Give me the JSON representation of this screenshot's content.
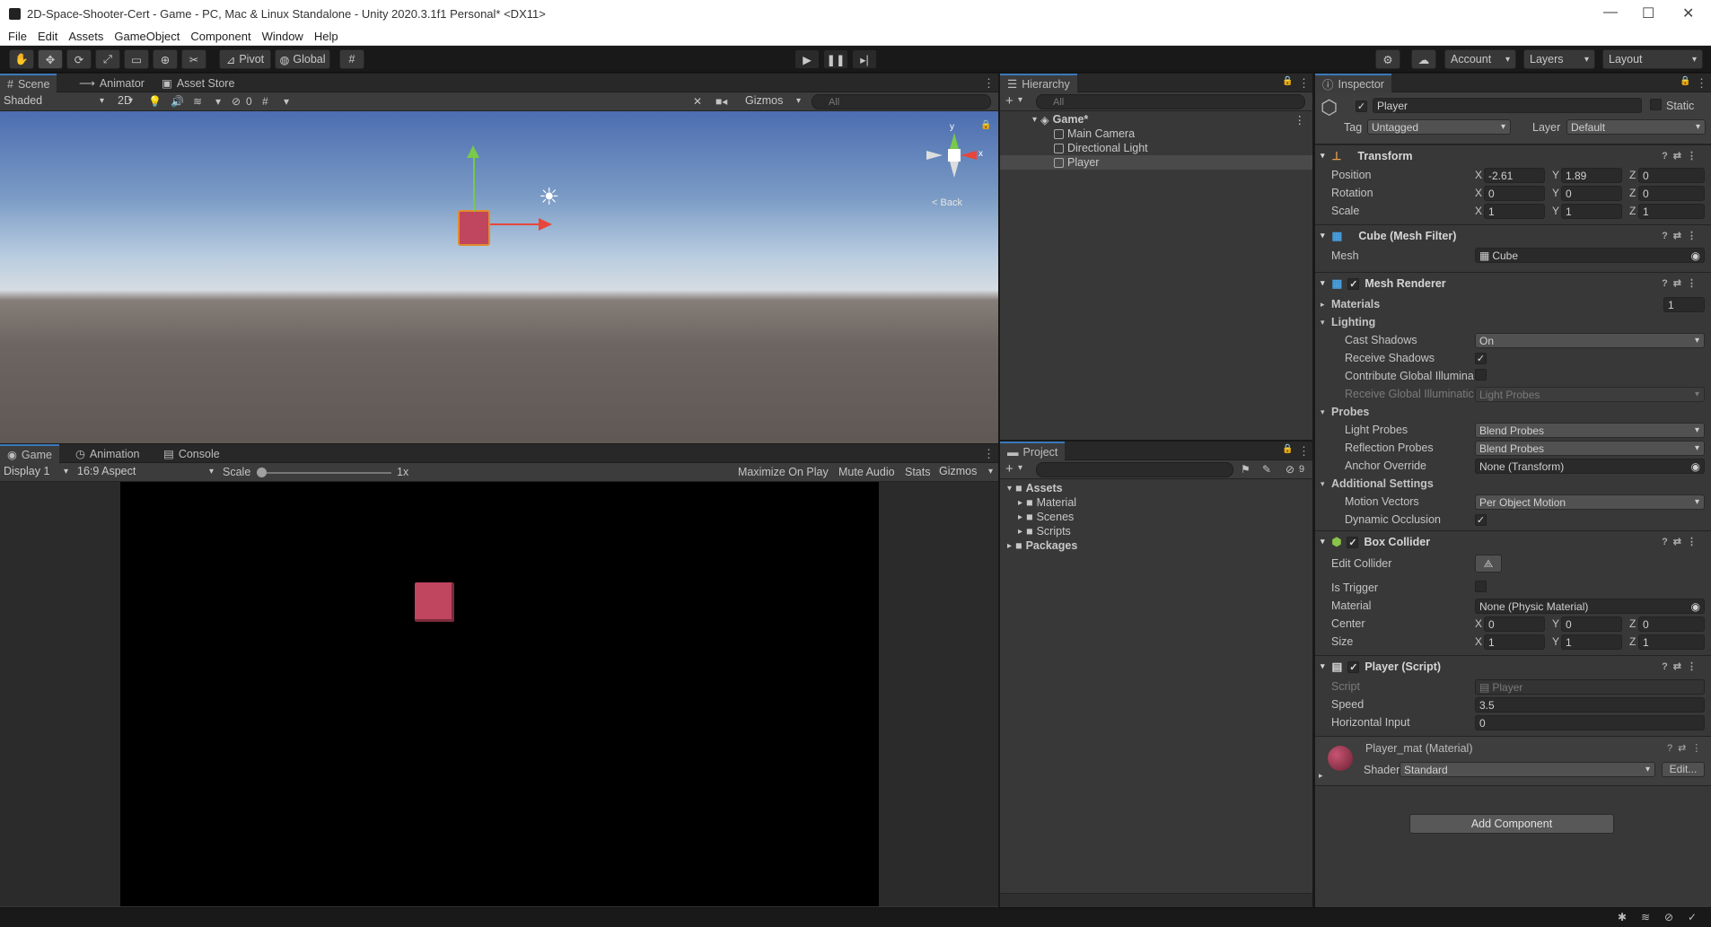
{
  "window": {
    "title": "2D-Space-Shooter-Cert - Game - PC, Mac & Linux Standalone - Unity 2020.3.1f1 Personal* <DX11>"
  },
  "menu": [
    "File",
    "Edit",
    "Assets",
    "GameObject",
    "Component",
    "Window",
    "Help"
  ],
  "toolbar": {
    "pivot": "Pivot",
    "global": "Global",
    "account": "Account",
    "layers": "Layers",
    "layout": "Layout"
  },
  "scene_panel": {
    "tabs": [
      "Scene",
      "Animator",
      "Asset Store"
    ],
    "shading": "Shaded",
    "mode_2d": "2D",
    "hidden_count": "0",
    "gizmos": "Gizmos",
    "search_placeholder": "All",
    "back_label": "Back",
    "axis_y": "y",
    "axis_x": "x"
  },
  "game_panel": {
    "tabs": [
      "Game",
      "Animation",
      "Console"
    ],
    "display": "Display 1",
    "aspect": "16:9 Aspect",
    "scale_label": "Scale",
    "scale_value": "1x",
    "scale_fraction": 0.0,
    "maximize": "Maximize On Play",
    "mute": "Mute Audio",
    "stats": "Stats",
    "gizmos": "Gizmos"
  },
  "hierarchy": {
    "title": "Hierarchy",
    "search_placeholder": "All",
    "scene": "Game*",
    "items": [
      "Main Camera",
      "Directional Light",
      "Player"
    ],
    "selected": "Player"
  },
  "project": {
    "title": "Project",
    "hidden_count": "9",
    "assets": "Assets",
    "folders": [
      "Material",
      "Scenes",
      "Scripts"
    ],
    "packages": "Packages"
  },
  "inspector": {
    "title": "Inspector",
    "object_name": "Player",
    "static_label": "Static",
    "tag_label": "Tag",
    "tag_value": "Untagged",
    "layer_label": "Layer",
    "layer_value": "Default",
    "transform": {
      "title": "Transform",
      "position_label": "Position",
      "position": {
        "x": "-2.61",
        "y": "1.89",
        "z": "0"
      },
      "rotation_label": "Rotation",
      "rotation": {
        "x": "0",
        "y": "0",
        "z": "0"
      },
      "scale_label": "Scale",
      "scale": {
        "x": "1",
        "y": "1",
        "z": "1"
      }
    },
    "mesh_filter": {
      "title": "Cube (Mesh Filter)",
      "mesh_label": "Mesh",
      "mesh_value": "Cube"
    },
    "mesh_renderer": {
      "title": "Mesh Renderer",
      "materials_label": "Materials",
      "materials_count": "1",
      "lighting_label": "Lighting",
      "cast_shadows_label": "Cast Shadows",
      "cast_shadows": "On",
      "receive_shadows_label": "Receive Shadows",
      "contribute_gi_label": "Contribute Global Illumina",
      "receive_gi_label": "Receive Global Illuminatic",
      "receive_gi": "Light Probes",
      "probes_label": "Probes",
      "light_probes_label": "Light Probes",
      "light_probes": "Blend Probes",
      "reflection_probes_label": "Reflection Probes",
      "reflection_probes": "Blend Probes",
      "anchor_override_label": "Anchor Override",
      "anchor_override": "None (Transform)",
      "additional_label": "Additional Settings",
      "motion_vectors_label": "Motion Vectors",
      "motion_vectors": "Per Object Motion",
      "dynamic_occlusion_label": "Dynamic Occlusion"
    },
    "box_collider": {
      "title": "Box Collider",
      "edit_collider_label": "Edit Collider",
      "is_trigger_label": "Is Trigger",
      "material_label": "Material",
      "material": "None (Physic Material)",
      "center_label": "Center",
      "center": {
        "x": "0",
        "y": "0",
        "z": "0"
      },
      "size_label": "Size",
      "size": {
        "x": "1",
        "y": "1",
        "z": "1"
      }
    },
    "player_script": {
      "title": "Player (Script)",
      "script_label": "Script",
      "script": "Player",
      "speed_label": "Speed",
      "speed": "3.5",
      "horizontal_label": "Horizontal Input",
      "horizontal": "0"
    },
    "material": {
      "title": "Player_mat (Material)",
      "shader_label": "Shader",
      "shader": "Standard",
      "edit": "Edit..."
    },
    "add_component": "Add Component"
  },
  "colors": {
    "accent": "#3a79bb",
    "player_cube": "#c0455e",
    "panel": "#383838"
  }
}
